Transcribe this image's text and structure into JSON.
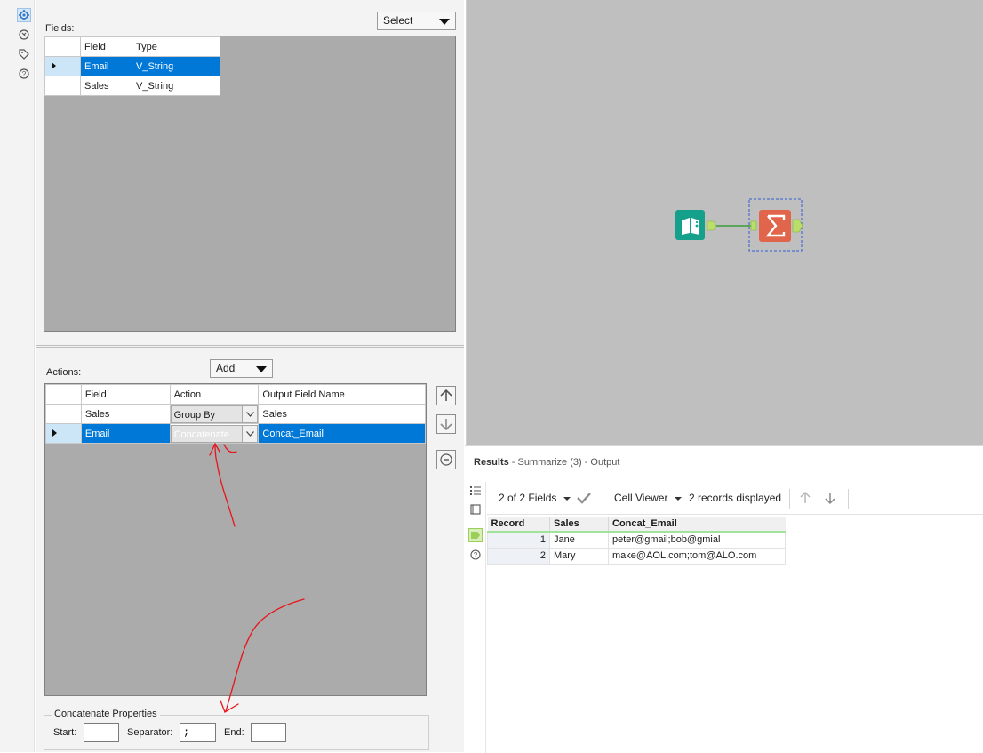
{
  "rail": {
    "icons": [
      "gear-icon",
      "tool-icon",
      "tag-icon",
      "help-icon"
    ]
  },
  "config": {
    "fields_label": "Fields:",
    "select_button": "Select",
    "fields_table": {
      "headers": [
        "Field",
        "Type"
      ],
      "rows": [
        {
          "field": "Email",
          "type": "V_String",
          "selected": true
        },
        {
          "field": "Sales",
          "type": "V_String",
          "selected": false
        }
      ]
    },
    "actions_label": "Actions:",
    "add_button": "Add",
    "actions_table": {
      "headers": [
        "Field",
        "Action",
        "Output Field Name"
      ],
      "rows": [
        {
          "field": "Sales",
          "action": "Group By",
          "output": "Sales",
          "selected": false
        },
        {
          "field": "Email",
          "action": "Concatenate",
          "output": "Concat_Email",
          "selected": true
        }
      ]
    },
    "concat": {
      "legend": "Concatenate Properties",
      "start_label": "Start:",
      "start_value": "",
      "separator_label": "Separator:",
      "separator_value": ";",
      "end_label": "End:",
      "end_value": ""
    }
  },
  "canvas": {
    "tools": [
      "input-data-tool",
      "summarize-tool"
    ],
    "colors": {
      "input": "#14a08b",
      "summarize": "#e0654a",
      "connector": "#3a9b3a",
      "anchor": "#b9df6a"
    }
  },
  "results": {
    "title_bold": "Results",
    "title_rest": " - Summarize (3) - Output",
    "fields_count": "2 of 2 Fields",
    "cell_viewer": "Cell Viewer",
    "records_displayed": "2 records displayed",
    "table": {
      "headers": [
        "Record",
        "Sales",
        "Concat_Email"
      ],
      "rows": [
        {
          "record": "1",
          "sales": "Jane",
          "concat": "peter@gmail;bob@gmial"
        },
        {
          "record": "2",
          "sales": "Mary",
          "concat": "make@AOL.com;tom@ALO.com"
        }
      ]
    }
  },
  "annotation_color": "#e8141b"
}
